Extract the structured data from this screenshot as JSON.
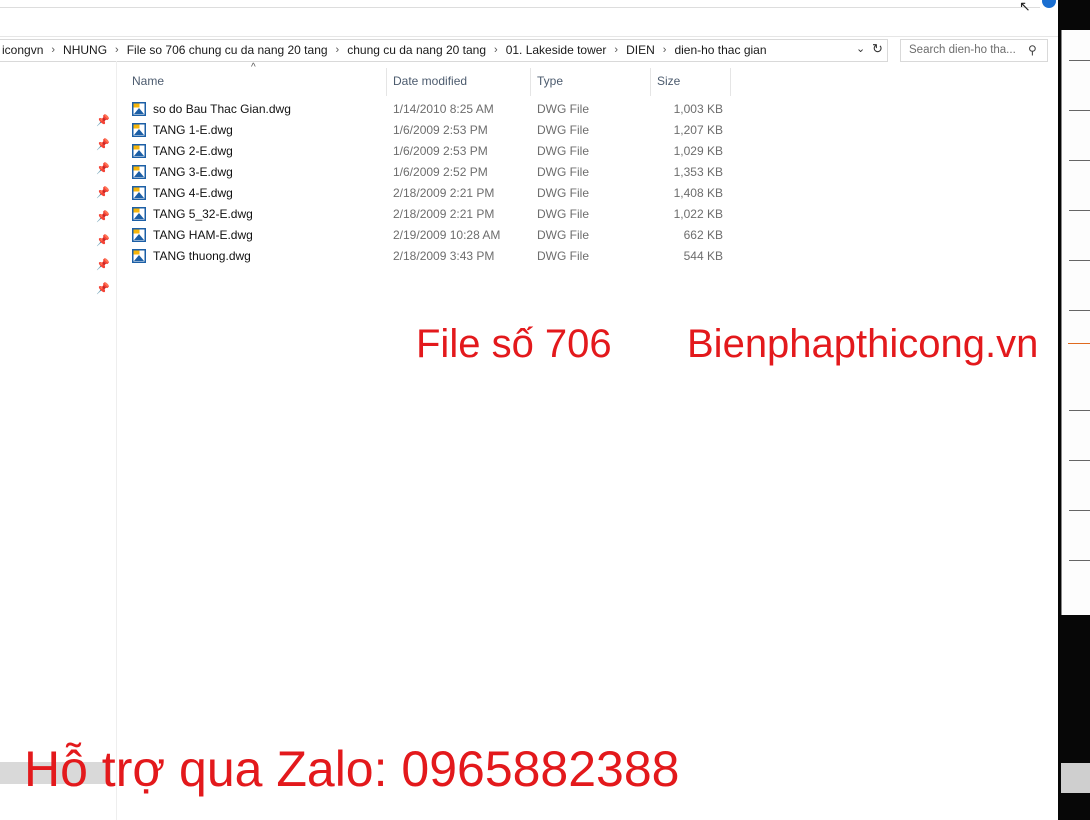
{
  "address_bar": {
    "crumbs": [
      "icongvn",
      "NHUNG",
      "File so 706 chung cu da nang 20 tang",
      "chung cu da nang 20 tang",
      "01. Lakeside tower",
      "DIEN",
      "dien-ho thac gian"
    ]
  },
  "search": {
    "placeholder": "Search dien-ho tha..."
  },
  "columns": {
    "name": "Name",
    "date_modified": "Date modified",
    "type": "Type",
    "size": "Size"
  },
  "files": [
    {
      "name": "so do Bau Thac Gian.dwg",
      "date": "1/14/2010 8:25 AM",
      "type": "DWG File",
      "size": "1,003 KB"
    },
    {
      "name": "TANG 1-E.dwg",
      "date": "1/6/2009 2:53 PM",
      "type": "DWG File",
      "size": "1,207 KB"
    },
    {
      "name": "TANG 2-E.dwg",
      "date": "1/6/2009 2:53 PM",
      "type": "DWG File",
      "size": "1,029 KB"
    },
    {
      "name": "TANG 3-E.dwg",
      "date": "1/6/2009 2:52 PM",
      "type": "DWG File",
      "size": "1,353 KB"
    },
    {
      "name": "TANG 4-E.dwg",
      "date": "2/18/2009 2:21 PM",
      "type": "DWG File",
      "size": "1,408 KB"
    },
    {
      "name": "TANG 5_32-E.dwg",
      "date": "2/18/2009 2:21 PM",
      "type": "DWG File",
      "size": "1,022 KB"
    },
    {
      "name": "TANG HAM-E.dwg",
      "date": "2/19/2009 10:28 AM",
      "type": "DWG File",
      "size": "662 KB"
    },
    {
      "name": "TANG thuong.dwg",
      "date": "2/18/2009 3:43 PM",
      "type": "DWG File",
      "size": "544 KB"
    }
  ],
  "watermark": {
    "file_no": "File số 706",
    "site": "Bienphapthicong.vn",
    "zalo": "Hỗ trợ qua Zalo: 0965882388"
  },
  "icons": {
    "file": "dwg-file-icon",
    "pin": "pin-icon",
    "search": "search-icon",
    "refresh": "refresh-icon",
    "dropdown": "chevron-down-icon",
    "separator": "chevron-right-icon"
  },
  "colors": {
    "watermark": "#e3191c",
    "dwg_icon_blue": "#1c5fa6",
    "dwg_icon_yellow": "#f5b50a"
  }
}
